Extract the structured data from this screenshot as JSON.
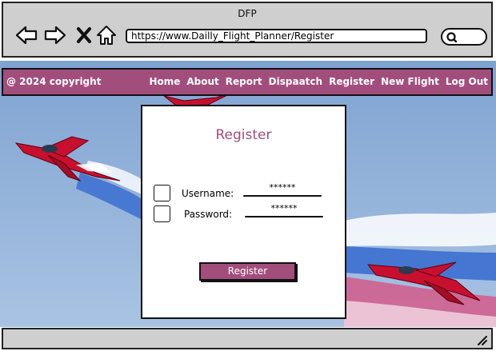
{
  "window": {
    "title": "DFP"
  },
  "browser": {
    "url": "https://www.Dailly_Flight_Planner/Register"
  },
  "navbar": {
    "copyright": "@ 2024 copyright",
    "links": [
      "Home",
      "About",
      "Report",
      "Dispaatch",
      "Register",
      "New Flight",
      "Log Out"
    ]
  },
  "register": {
    "title": "Register",
    "username_label": "Username:",
    "username_value": "******",
    "password_label": "Password:",
    "password_value": "******",
    "button_label": "Register"
  },
  "colors": {
    "accent": "#a24e7c",
    "chrome": "#cfcfcf",
    "sky": "#8fb2d8"
  },
  "icons": [
    "back-arrow-icon",
    "forward-arrow-icon",
    "close-icon",
    "home-icon",
    "search-icon",
    "resize-grip-icon"
  ]
}
